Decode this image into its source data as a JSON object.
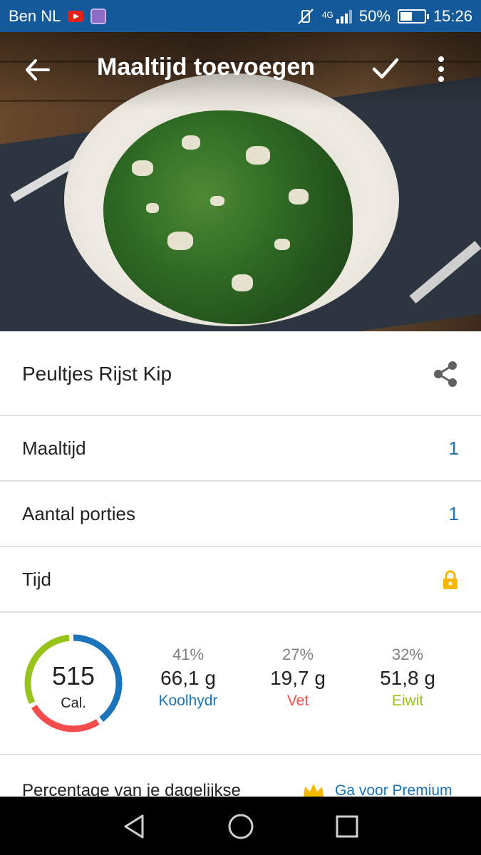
{
  "status_bar": {
    "carrier": "Ben NL",
    "network": "4G",
    "battery": "50%",
    "battery_level": 0.5,
    "time": "15:26"
  },
  "toolbar": {
    "title": "Maaltijd toevoegen",
    "back_icon": "arrow-back-icon",
    "confirm_icon": "check-icon",
    "more_icon": "more-vert-icon"
  },
  "meal": {
    "name": "Peultjes Rijst Kip",
    "share_icon": "share-icon"
  },
  "fields": [
    {
      "label": "Maaltijd",
      "value": "1"
    },
    {
      "label": "Aantal porties",
      "value": "1"
    },
    {
      "label": "Tijd",
      "value": "",
      "icon": "lock-icon"
    }
  ],
  "calories": {
    "value": "515",
    "unit": "Cal."
  },
  "macros": [
    {
      "pct": "41%",
      "grams": "66,1 g",
      "name": "Koolhydr",
      "color": "#1b73b9",
      "share": 0.41
    },
    {
      "pct": "27%",
      "grams": "19,7 g",
      "name": "Vet",
      "color": "#f24b4b",
      "share": 0.27
    },
    {
      "pct": "32%",
      "grams": "51,8 g",
      "name": "Eiwit",
      "color": "#97c31b",
      "share": 0.32
    }
  ],
  "premium": {
    "text": "Percentage van je dagelijkse",
    "link": "Ga voor Premium",
    "icon": "crown-icon"
  },
  "colors": {
    "status_bar": "#14599a",
    "accent_blue": "#1b73b9",
    "lock": "#f5b800"
  }
}
